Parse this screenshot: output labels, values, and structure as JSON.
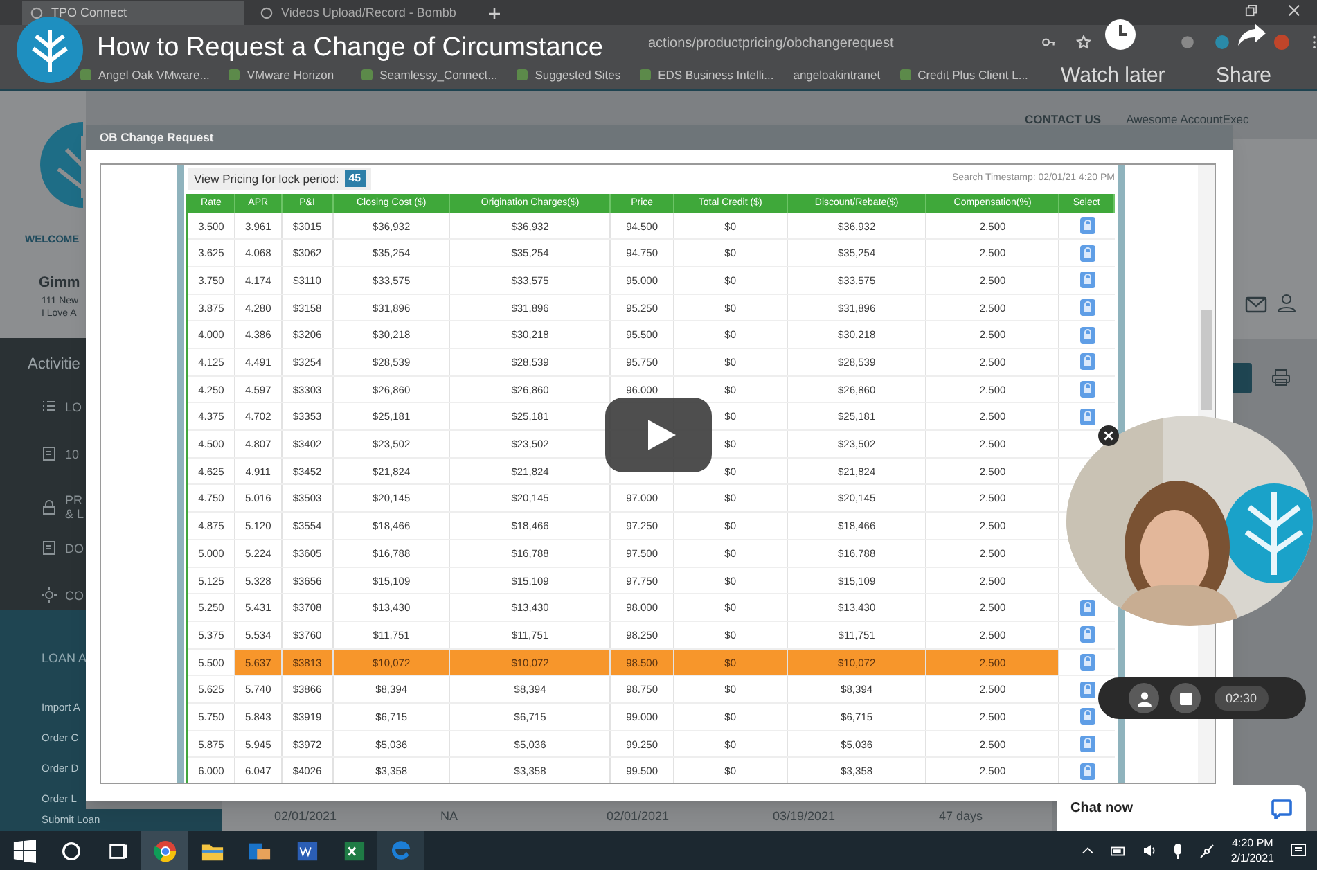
{
  "video": {
    "title": "How to Request a Change of Circumstance",
    "actions": [
      {
        "label": "Watch later",
        "kind": "clock"
      },
      {
        "label": "Share",
        "kind": "share"
      }
    ]
  },
  "browser": {
    "tabs": [
      {
        "label": "TPO Connect",
        "selected": true
      },
      {
        "label": "Videos Upload/Record - Bombb",
        "selected": false
      }
    ],
    "address": "actions/productpricing/obchangerequest",
    "bookmarks": [
      "Angel Oak VMware...",
      "VMware Horizon",
      "Seamlessy_Connect...",
      "Suggested Sites",
      "EDS Business Intelli...",
      "angeloakintranet",
      "Credit Plus Client L..."
    ]
  },
  "header": {
    "links": [
      "CONTACT US",
      "Awesome AccountExec"
    ]
  },
  "sidebar": {
    "welcome": "WELCOME",
    "name": "Gimm",
    "address_lines": [
      "111 New",
      "I Love A"
    ],
    "section": "Activitie",
    "items": [
      {
        "label": "LO",
        "kind": "list"
      },
      {
        "label": "10",
        "kind": "doc"
      },
      {
        "label": "PR\n& L",
        "kind": "lock"
      },
      {
        "label": "DO",
        "kind": "doc"
      },
      {
        "label": "CO",
        "kind": "gear"
      }
    ],
    "loan_section": "LOAN A",
    "loan_items": [
      "Import A",
      "Order C",
      "Order D",
      "Order L",
      "Submit Loan"
    ]
  },
  "background_row": [
    "02/01/2021",
    "NA",
    "02/01/2021",
    "03/19/2021",
    "47 days"
  ],
  "dialog": {
    "title": "OB Change Request",
    "lock_period_label": "View Pricing for lock period:",
    "lock_period": "45",
    "timestamp": "Search Timestamp: 02/01/21 4:20 PM",
    "columns": [
      "Rate",
      "APR",
      "P&I",
      "Closing Cost ($)",
      "Origination Charges($)",
      "Price",
      "Total Credit ($)",
      "Discount/Rebate($)",
      "Compensation(%)",
      "Select"
    ],
    "rows": [
      {
        "rate": "3.500",
        "apr": "3.961",
        "pi": "$3015",
        "closing": "$36,932",
        "origination": "$36,932",
        "price": "94.500",
        "credit": "$0",
        "discount": "$36,932",
        "comp": "2.500",
        "selected": false
      },
      {
        "rate": "3.625",
        "apr": "4.068",
        "pi": "$3062",
        "closing": "$35,254",
        "origination": "$35,254",
        "price": "94.750",
        "credit": "$0",
        "discount": "$35,254",
        "comp": "2.500",
        "selected": false
      },
      {
        "rate": "3.750",
        "apr": "4.174",
        "pi": "$3110",
        "closing": "$33,575",
        "origination": "$33,575",
        "price": "95.000",
        "credit": "$0",
        "discount": "$33,575",
        "comp": "2.500",
        "selected": false
      },
      {
        "rate": "3.875",
        "apr": "4.280",
        "pi": "$3158",
        "closing": "$31,896",
        "origination": "$31,896",
        "price": "95.250",
        "credit": "$0",
        "discount": "$31,896",
        "comp": "2.500",
        "selected": false
      },
      {
        "rate": "4.000",
        "apr": "4.386",
        "pi": "$3206",
        "closing": "$30,218",
        "origination": "$30,218",
        "price": "95.500",
        "credit": "$0",
        "discount": "$30,218",
        "comp": "2.500",
        "selected": false
      },
      {
        "rate": "4.125",
        "apr": "4.491",
        "pi": "$3254",
        "closing": "$28,539",
        "origination": "$28,539",
        "price": "95.750",
        "credit": "$0",
        "discount": "$28,539",
        "comp": "2.500",
        "selected": false
      },
      {
        "rate": "4.250",
        "apr": "4.597",
        "pi": "$3303",
        "closing": "$26,860",
        "origination": "$26,860",
        "price": "96.000",
        "credit": "$0",
        "discount": "$26,860",
        "comp": "2.500",
        "selected": false
      },
      {
        "rate": "4.375",
        "apr": "4.702",
        "pi": "$3353",
        "closing": "$25,181",
        "origination": "$25,181",
        "credit": "$0",
        "discount": "$25,181",
        "comp": "2.500",
        "selected": false
      },
      {
        "rate": "4.500",
        "apr": "4.807",
        "pi": "$3402",
        "closing": "$23,502",
        "origination": "$23,502",
        "credit": "$0",
        "discount": "$23,502",
        "comp": "2.500",
        "selected": false
      },
      {
        "rate": "4.625",
        "apr": "4.911",
        "pi": "$3452",
        "closing": "$21,824",
        "origination": "$21,824",
        "credit": "$0",
        "discount": "$21,824",
        "comp": "2.500",
        "selected": false
      },
      {
        "rate": "4.750",
        "apr": "5.016",
        "pi": "$3503",
        "closing": "$20,145",
        "origination": "$20,145",
        "price": "97.000",
        "credit": "$0",
        "discount": "$20,145",
        "comp": "2.500",
        "selected": false
      },
      {
        "rate": "4.875",
        "apr": "5.120",
        "pi": "$3554",
        "closing": "$18,466",
        "origination": "$18,466",
        "price": "97.250",
        "credit": "$0",
        "discount": "$18,466",
        "comp": "2.500",
        "selected": false
      },
      {
        "rate": "5.000",
        "apr": "5.224",
        "pi": "$3605",
        "closing": "$16,788",
        "origination": "$16,788",
        "price": "97.500",
        "credit": "$0",
        "discount": "$16,788",
        "comp": "2.500",
        "selected": false
      },
      {
        "rate": "5.125",
        "apr": "5.328",
        "pi": "$3656",
        "closing": "$15,109",
        "origination": "$15,109",
        "price": "97.750",
        "credit": "$0",
        "discount": "$15,109",
        "comp": "2.500",
        "selected": false
      },
      {
        "rate": "5.250",
        "apr": "5.431",
        "pi": "$3708",
        "closing": "$13,430",
        "origination": "$13,430",
        "price": "98.000",
        "credit": "$0",
        "discount": "$13,430",
        "comp": "2.500",
        "selected": false
      },
      {
        "rate": "5.375",
        "apr": "5.534",
        "pi": "$3760",
        "closing": "$11,751",
        "origination": "$11,751",
        "price": "98.250",
        "credit": "$0",
        "discount": "$11,751",
        "comp": "2.500",
        "selected": false
      },
      {
        "rate": "5.500",
        "apr": "5.637",
        "pi": "$3813",
        "closing": "$10,072",
        "origination": "$10,072",
        "price": "98.500",
        "credit": "$0",
        "discount": "$10,072",
        "comp": "2.500",
        "selected": true
      },
      {
        "rate": "5.625",
        "apr": "5.740",
        "pi": "$3866",
        "closing": "$8,394",
        "origination": "$8,394",
        "price": "98.750",
        "credit": "$0",
        "discount": "$8,394",
        "comp": "2.500",
        "selected": false
      },
      {
        "rate": "5.750",
        "apr": "5.843",
        "pi": "$3919",
        "closing": "$6,715",
        "origination": "$6,715",
        "price": "99.000",
        "credit": "$0",
        "discount": "$6,715",
        "comp": "2.500",
        "selected": false
      },
      {
        "rate": "5.875",
        "apr": "5.945",
        "pi": "$3972",
        "closing": "$5,036",
        "origination": "$5,036",
        "price": "99.250",
        "credit": "$0",
        "discount": "$5,036",
        "comp": "2.500",
        "selected": false
      },
      {
        "rate": "6.000",
        "apr": "6.047",
        "pi": "$4026",
        "closing": "$3,358",
        "origination": "$3,358",
        "price": "99.500",
        "credit": "$0",
        "discount": "$3,358",
        "comp": "2.500",
        "selected": false
      }
    ]
  },
  "recorder": {
    "timer": "02:30"
  },
  "chat": {
    "label": "Chat now"
  },
  "taskbar": {
    "time": "4:20 PM",
    "date": "2/1/2021"
  }
}
